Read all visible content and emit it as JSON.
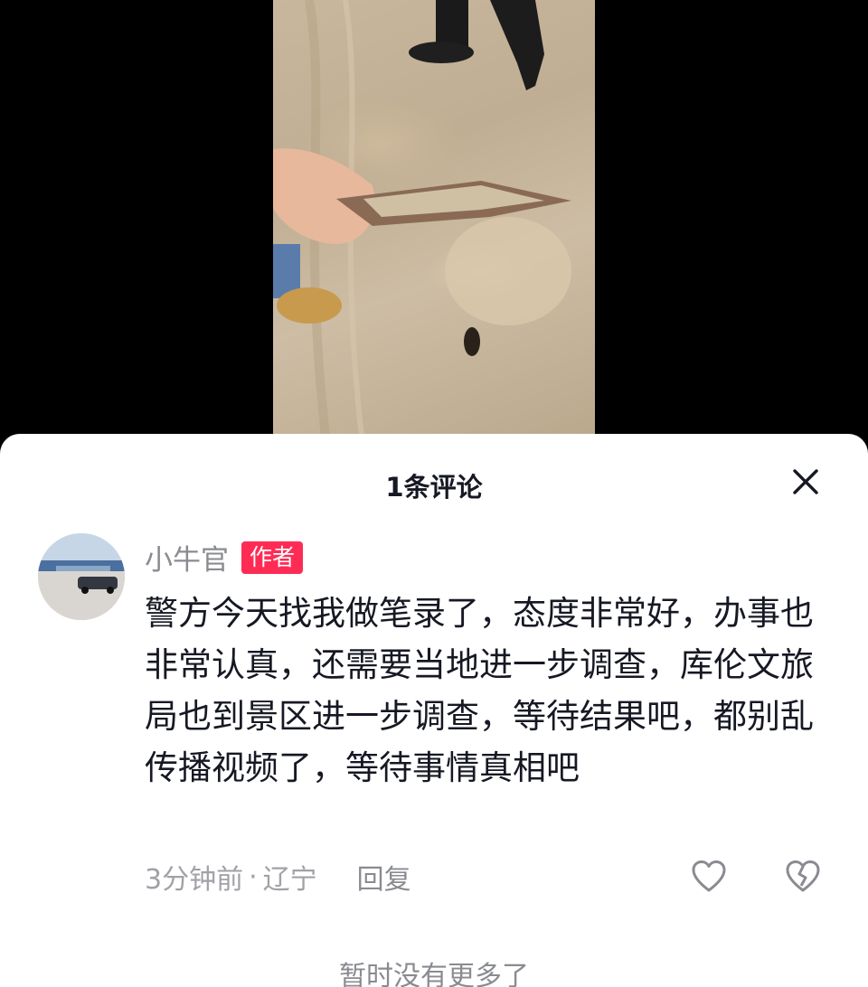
{
  "video": {
    "icon": "video-frame"
  },
  "sheet": {
    "title": "1条评论",
    "close_icon": "close-icon"
  },
  "comment": {
    "username": "小牛官",
    "badge": "作者",
    "text": "警方今天找我做笔录了，态度非常好，办事也非常认真，还需要当地进一步调查，库伦文旅局也到景区进一步调查，等待结果吧，都别乱传播视频了，等待事情真相吧",
    "time": "3分钟前",
    "dot": "·",
    "location": "辽宁",
    "reply_label": "回复",
    "like_icon": "heart-outline-icon",
    "dislike_icon": "broken-heart-icon"
  },
  "footer": {
    "no_more": "暂时没有更多了"
  },
  "colors": {
    "accent": "#fe2c55",
    "text": "#161823",
    "muted": "#a1a2a7"
  }
}
